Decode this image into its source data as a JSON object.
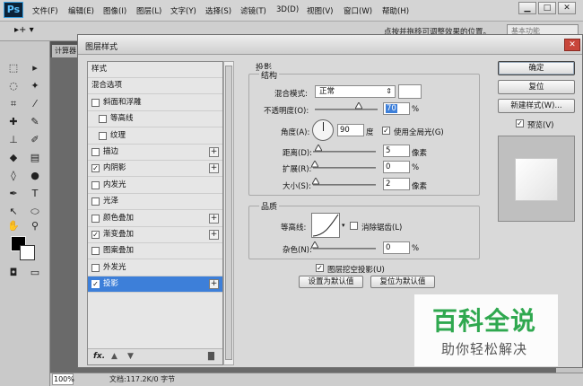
{
  "app": {
    "logo": "Ps",
    "menus": [
      "文件(F)",
      "编辑(E)",
      "图像(I)",
      "图层(L)",
      "文字(Y)",
      "选择(S)",
      "滤镜(T)",
      "3D(D)",
      "视图(V)",
      "窗口(W)",
      "帮助(H)"
    ],
    "window_buttons": [
      "▁",
      "□",
      "✕"
    ]
  },
  "options_bar": {
    "tool_glyph": "▸+ ▾",
    "hint": "点按并拖移可调整效果的位置。",
    "workspace": "基本功能"
  },
  "document": {
    "tab": "计算器",
    "zoom": "100%",
    "status": "文档:117.2K/0 字节"
  },
  "dialog": {
    "title": "图层样式",
    "close": "✕",
    "style_list": {
      "items": [
        {
          "label": "样式",
          "has_checkbox": false,
          "checked": false,
          "has_plus": false,
          "indent": 0
        },
        {
          "label": "混合选项",
          "has_checkbox": false,
          "checked": false,
          "has_plus": false,
          "indent": 0
        },
        {
          "label": "斜面和浮雕",
          "has_checkbox": true,
          "checked": false,
          "has_plus": false,
          "indent": 0
        },
        {
          "label": "等高线",
          "has_checkbox": true,
          "checked": false,
          "has_plus": false,
          "indent": 1
        },
        {
          "label": "纹理",
          "has_checkbox": true,
          "checked": false,
          "has_plus": false,
          "indent": 1
        },
        {
          "label": "描边",
          "has_checkbox": true,
          "checked": false,
          "has_plus": true,
          "indent": 0
        },
        {
          "label": "内阴影",
          "has_checkbox": true,
          "checked": true,
          "has_plus": true,
          "indent": 0
        },
        {
          "label": "内发光",
          "has_checkbox": true,
          "checked": false,
          "has_plus": false,
          "indent": 0
        },
        {
          "label": "光泽",
          "has_checkbox": true,
          "checked": false,
          "has_plus": false,
          "indent": 0
        },
        {
          "label": "颜色叠加",
          "has_checkbox": true,
          "checked": false,
          "has_plus": true,
          "indent": 0
        },
        {
          "label": "渐变叠加",
          "has_checkbox": true,
          "checked": true,
          "has_plus": true,
          "indent": 0
        },
        {
          "label": "图案叠加",
          "has_checkbox": true,
          "checked": false,
          "has_plus": false,
          "indent": 0
        },
        {
          "label": "外发光",
          "has_checkbox": true,
          "checked": false,
          "has_plus": false,
          "indent": 0
        },
        {
          "label": "投影",
          "has_checkbox": true,
          "checked": true,
          "has_plus": true,
          "indent": 0,
          "selected": true
        }
      ],
      "footer": {
        "fx": "fx.",
        "up": "▲",
        "down": "▼",
        "delete": "🗑"
      }
    },
    "drop_shadow": {
      "section_title": "投影",
      "structure_title": "结构",
      "blend_mode_label": "混合模式:",
      "blend_mode_value": "正常",
      "opacity_label": "不透明度(O):",
      "opacity_value": "70",
      "opacity_unit": "%",
      "opacity_level": 0.7,
      "angle_label": "角度(A):",
      "angle_value": "90",
      "angle_unit": "度",
      "global_light_label": "使用全局光(G)",
      "global_light_checked": true,
      "distance_label": "距离(D):",
      "distance_value": "5",
      "distance_unit": "像素",
      "spread_label": "扩展(R):",
      "spread_value": "0",
      "spread_unit": "%",
      "size_label": "大小(S):",
      "size_value": "2",
      "size_unit": "像素",
      "quality_title": "品质",
      "contour_label": "等高线:",
      "antialias_label": "消除锯齿(L)",
      "antialias_checked": false,
      "noise_label": "杂色(N):",
      "noise_value": "0",
      "noise_unit": "%",
      "knockout_label": "图层挖空投影(U)",
      "knockout_checked": true,
      "make_default": "设置为默认值",
      "reset_default": "复位为默认值"
    },
    "buttons": {
      "ok": "确定",
      "reset": "复位",
      "new_style": "新建样式(W)...",
      "preview_label": "预览(V)",
      "preview_checked": true
    }
  },
  "watermark": {
    "title": "百科全说",
    "subtitle": "助你轻松解决"
  }
}
